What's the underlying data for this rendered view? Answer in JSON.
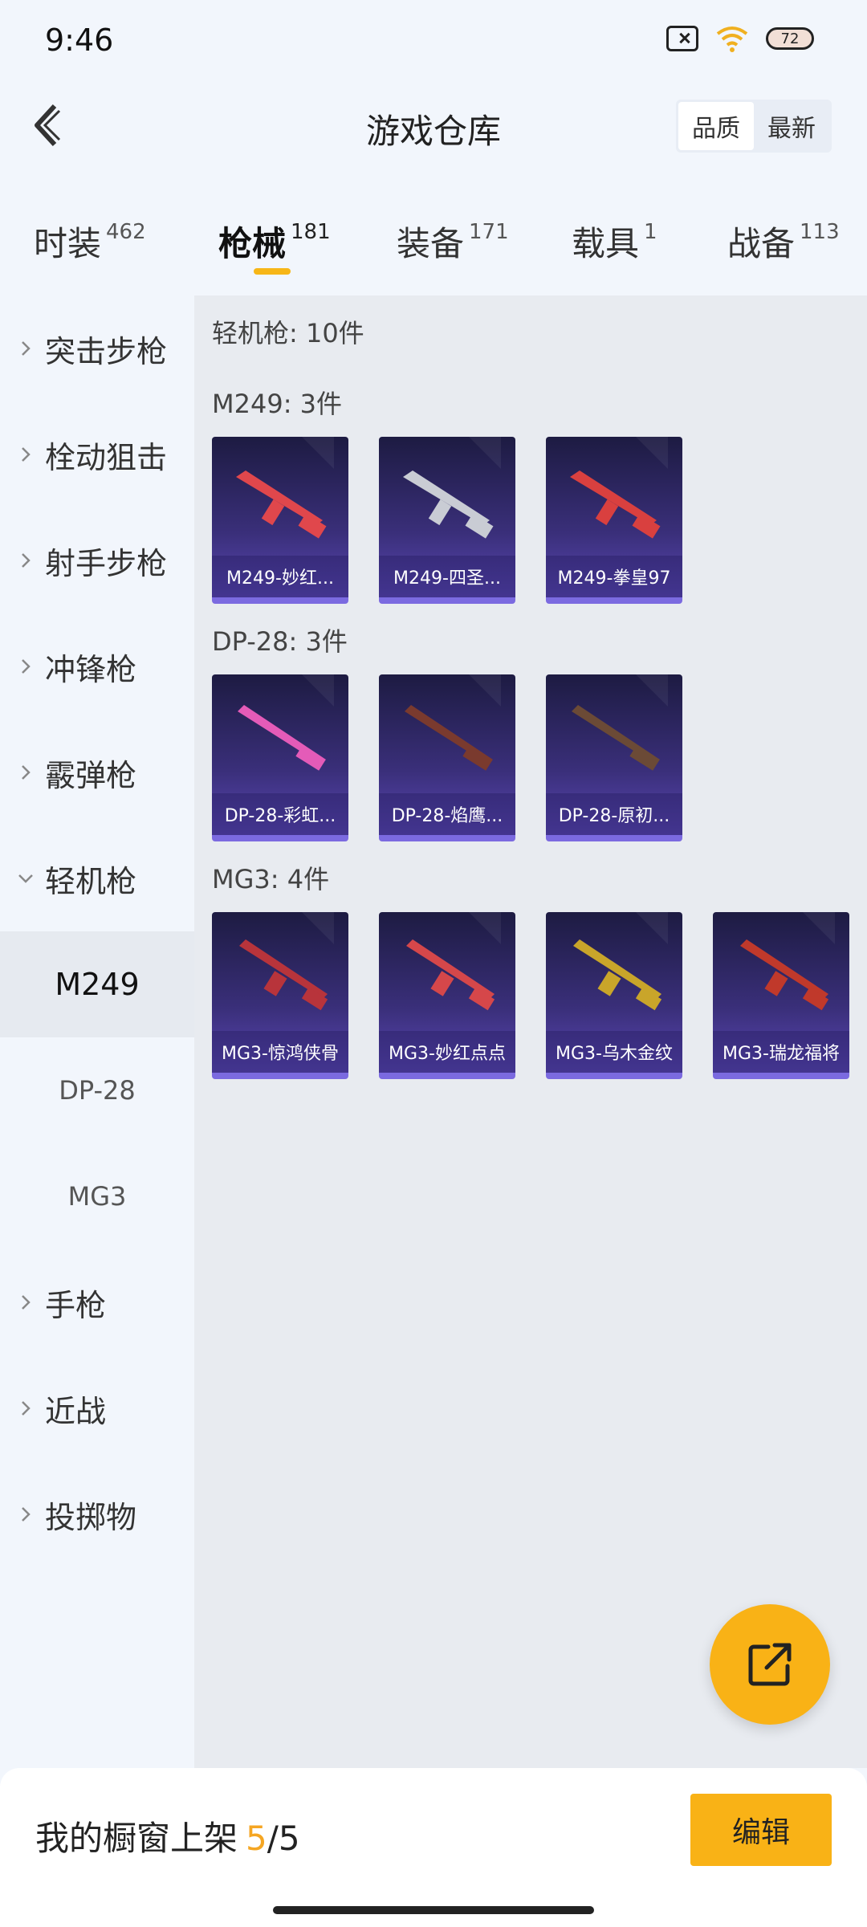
{
  "status_bar": {
    "time": "9:46",
    "battery": "72"
  },
  "header": {
    "title": "游戏仓库",
    "sort_options": [
      {
        "label": "品质",
        "active": true
      },
      {
        "label": "最新",
        "active": false
      }
    ]
  },
  "tabs": [
    {
      "label": "时装",
      "count": "462",
      "active": false
    },
    {
      "label": "枪械",
      "count": "181",
      "active": true
    },
    {
      "label": "装备",
      "count": "171",
      "active": false
    },
    {
      "label": "载具",
      "count": "1",
      "active": false
    },
    {
      "label": "战备",
      "count": "113",
      "active": false
    }
  ],
  "sidebar": {
    "categories": [
      {
        "label": "突击步枪",
        "expanded": false
      },
      {
        "label": "栓动狙击",
        "expanded": false
      },
      {
        "label": "射手步枪",
        "expanded": false
      },
      {
        "label": "冲锋枪",
        "expanded": false
      },
      {
        "label": "霰弹枪",
        "expanded": false
      },
      {
        "label": "轻机枪",
        "expanded": true
      },
      {
        "label": "手枪",
        "expanded": false
      },
      {
        "label": "近战",
        "expanded": false
      },
      {
        "label": "投掷物",
        "expanded": false
      }
    ],
    "subitems": [
      {
        "label": "M249",
        "active": true
      },
      {
        "label": "DP-28",
        "active": false
      },
      {
        "label": "MG3",
        "active": false
      }
    ]
  },
  "content": {
    "summary": "轻机枪: 10件",
    "groups": [
      {
        "title": "M249: 3件",
        "items": [
          {
            "label": "M249-妙红...",
            "color": "#e0474c"
          },
          {
            "label": "M249-四圣...",
            "color": "#c9ccd4"
          },
          {
            "label": "M249-拳皇97",
            "color": "#d9403f"
          }
        ]
      },
      {
        "title": "DP-28: 3件",
        "items": [
          {
            "label": "DP-28-彩虹...",
            "color": "#e45bb8"
          },
          {
            "label": "DP-28-焰鹰...",
            "color": "#7a3a2e"
          },
          {
            "label": "DP-28-原初...",
            "color": "#6b4a36"
          }
        ]
      },
      {
        "title": "MG3: 4件",
        "items": [
          {
            "label": "MG3-惊鸿侠骨",
            "color": "#b8343b"
          },
          {
            "label": "MG3-妙红点点",
            "color": "#d5474a"
          },
          {
            "label": "MG3-乌木金纹",
            "color": "#c9a52a"
          },
          {
            "label": "MG3-瑞龙福将",
            "color": "#c0392b"
          }
        ]
      }
    ]
  },
  "bottom_bar": {
    "shelf_label": "我的橱窗上架",
    "shelf_count": "5",
    "shelf_total": "/5",
    "edit_label": "编辑"
  },
  "colors": {
    "accent": "#f9b216",
    "card_bg": "#3a2f7a"
  }
}
